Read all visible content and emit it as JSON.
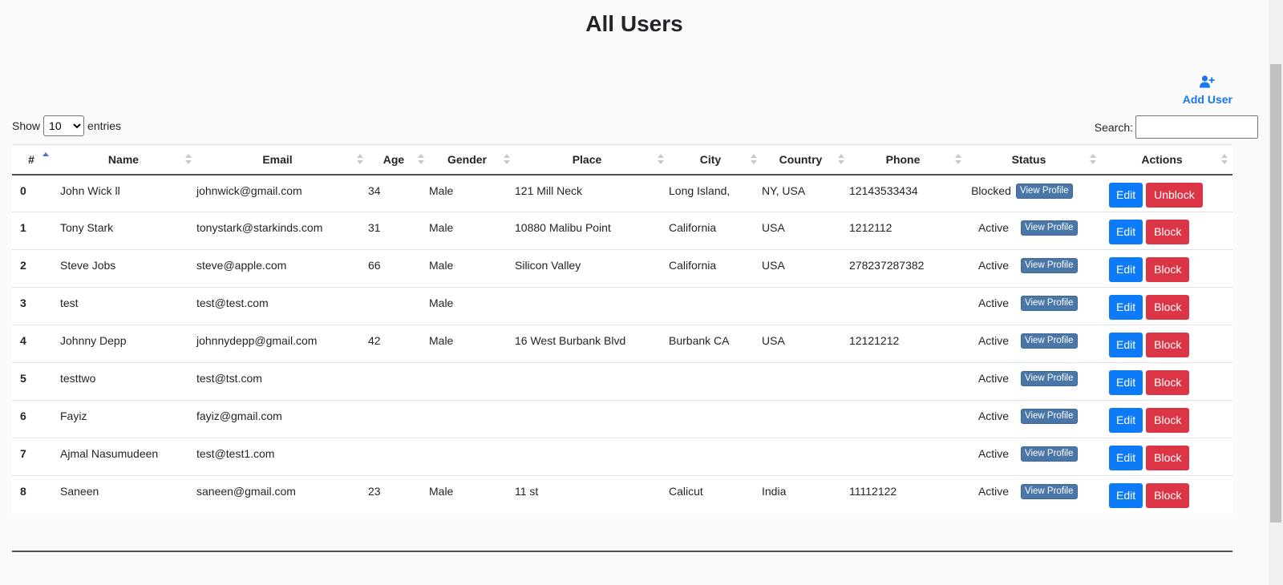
{
  "title": "All Users",
  "add_user_label": "Add User",
  "length": {
    "show_label": "Show",
    "selected": "10",
    "entries_label": "entries"
  },
  "search": {
    "label": "Search:",
    "value": ""
  },
  "columns": [
    "#",
    "Name",
    "Email",
    "Age",
    "Gender",
    "Place",
    "City",
    "Country",
    "Phone",
    "Status",
    "Actions"
  ],
  "sorted_column": "#",
  "sort_direction": "asc",
  "buttons": {
    "view_profile": "View Profile",
    "edit": "Edit"
  },
  "colors": {
    "edit": "#0d7bf7",
    "block": "#dc3545",
    "view_profile": "#4a77a8",
    "link": "#1877f2"
  },
  "rows": [
    {
      "idx": "0",
      "name": "John Wick ll",
      "email": "johnwick@gmail.com",
      "age": "34",
      "gender": "Male",
      "place": "121 Mill Neck",
      "city": "Long Island,",
      "country": "NY, USA",
      "phone": "12143533434",
      "status": "Blocked",
      "action": "Unblock"
    },
    {
      "idx": "1",
      "name": "Tony Stark",
      "email": "tonystark@starkinds.com",
      "age": "31",
      "gender": "Male",
      "place": "10880 Malibu Point",
      "city": "California",
      "country": "USA",
      "phone": "1212112",
      "status": "Active",
      "action": "Block"
    },
    {
      "idx": "2",
      "name": "Steve Jobs",
      "email": "steve@apple.com",
      "age": "66",
      "gender": "Male",
      "place": "Silicon Valley",
      "city": "California",
      "country": "USA",
      "phone": "278237287382",
      "status": "Active",
      "action": "Block"
    },
    {
      "idx": "3",
      "name": "test",
      "email": "test@test.com",
      "age": "",
      "gender": "Male",
      "place": "",
      "city": "",
      "country": "",
      "phone": "",
      "status": "Active",
      "action": "Block"
    },
    {
      "idx": "4",
      "name": "Johnny Depp",
      "email": "johnnydepp@gmail.com",
      "age": "42",
      "gender": "Male",
      "place": "16 West Burbank Blvd",
      "city": "Burbank CA",
      "country": "USA",
      "phone": "12121212",
      "status": "Active",
      "action": "Block"
    },
    {
      "idx": "5",
      "name": "testtwo",
      "email": "test@tst.com",
      "age": "",
      "gender": "",
      "place": "",
      "city": "",
      "country": "",
      "phone": "",
      "status": "Active",
      "action": "Block"
    },
    {
      "idx": "6",
      "name": "Fayiz",
      "email": "fayiz@gmail.com",
      "age": "",
      "gender": "",
      "place": "",
      "city": "",
      "country": "",
      "phone": "",
      "status": "Active",
      "action": "Block"
    },
    {
      "idx": "7",
      "name": "Ajmal Nasumudeen",
      "email": "test@test1.com",
      "age": "",
      "gender": "",
      "place": "",
      "city": "",
      "country": "",
      "phone": "",
      "status": "Active",
      "action": "Block"
    },
    {
      "idx": "8",
      "name": "Saneen",
      "email": "saneen@gmail.com",
      "age": "23",
      "gender": "Male",
      "place": "11 st",
      "city": "Calicut",
      "country": "India",
      "phone": "11112122",
      "status": "Active",
      "action": "Block"
    }
  ]
}
